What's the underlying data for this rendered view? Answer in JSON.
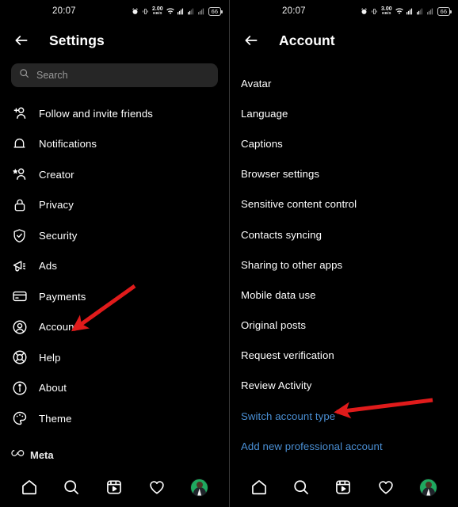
{
  "status_bar": {
    "time": "20:07",
    "icons": [
      "alarm-icon",
      "vibrate-icon",
      "data-speed",
      "wifi-icon",
      "sim1-signal-icon",
      "sim2-signal-icon",
      "battery-icon"
    ],
    "left_data_speed_value": "2.00",
    "right_data_speed_value": "3.00",
    "data_speed_unit": "KB/S",
    "battery_level": "66"
  },
  "left_screen": {
    "title": "Settings",
    "back_icon": "arrow-left-icon",
    "search": {
      "placeholder": "Search",
      "icon": "search-icon"
    },
    "items": [
      {
        "label": "Follow and invite friends",
        "icon": "person-add-icon"
      },
      {
        "label": "Notifications",
        "icon": "bell-icon"
      },
      {
        "label": "Creator",
        "icon": "person-star-icon"
      },
      {
        "label": "Privacy",
        "icon": "lock-icon"
      },
      {
        "label": "Security",
        "icon": "shield-check-icon"
      },
      {
        "label": "Ads",
        "icon": "megaphone-icon"
      },
      {
        "label": "Payments",
        "icon": "credit-card-icon"
      },
      {
        "label": "Account",
        "icon": "person-circle-icon"
      },
      {
        "label": "Help",
        "icon": "lifebuoy-icon"
      },
      {
        "label": "About",
        "icon": "info-circle-icon"
      },
      {
        "label": "Theme",
        "icon": "palette-icon"
      }
    ],
    "footer": {
      "label": "Meta",
      "icon": "meta-infinity-icon"
    },
    "annotation": {
      "type": "red-arrow",
      "points_to": "Account",
      "color": "#e01b1b"
    }
  },
  "right_screen": {
    "title": "Account",
    "back_icon": "arrow-left-icon",
    "items": [
      {
        "label": "Avatar",
        "style": "default"
      },
      {
        "label": "Language",
        "style": "default"
      },
      {
        "label": "Captions",
        "style": "default"
      },
      {
        "label": "Browser settings",
        "style": "default"
      },
      {
        "label": "Sensitive content control",
        "style": "default"
      },
      {
        "label": "Contacts syncing",
        "style": "default"
      },
      {
        "label": "Sharing to other apps",
        "style": "default"
      },
      {
        "label": "Mobile data use",
        "style": "default"
      },
      {
        "label": "Original posts",
        "style": "default"
      },
      {
        "label": "Request verification",
        "style": "default"
      },
      {
        "label": "Review Activity",
        "style": "default"
      },
      {
        "label": "Switch account type",
        "style": "link"
      },
      {
        "label": "Add new professional account",
        "style": "link"
      }
    ],
    "annotation": {
      "type": "red-arrow",
      "points_to": "Switch account type",
      "color": "#e01b1b"
    }
  },
  "bottom_nav": {
    "items": [
      {
        "name": "home",
        "icon": "home-icon"
      },
      {
        "name": "search",
        "icon": "search-icon"
      },
      {
        "name": "reels",
        "icon": "reels-icon"
      },
      {
        "name": "activity",
        "icon": "heart-icon"
      },
      {
        "name": "profile",
        "icon": "avatar-icon"
      }
    ]
  },
  "colors": {
    "background": "#000000",
    "text": "#ffffff",
    "link": "#4a8fd4",
    "search_field": "#262626",
    "annotation_red": "#e01b1b",
    "avatar_green": "#1fa85f"
  }
}
